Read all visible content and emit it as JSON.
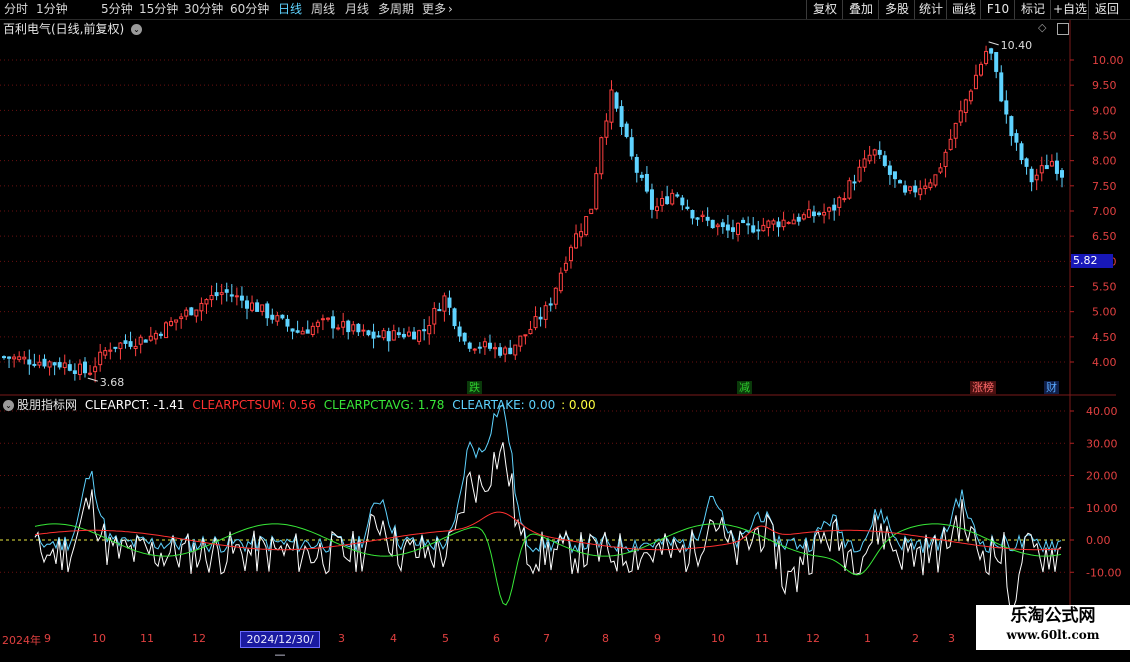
{
  "toolbar": {
    "periods": [
      "分时",
      "1分钟",
      "5分钟",
      "15分钟",
      "30分钟",
      "60分钟",
      "日线",
      "周线",
      "月线",
      "多周期"
    ],
    "active_period": "日线",
    "more_label": "更多",
    "more_icon": "chevron-right-icon",
    "actions": [
      "复权",
      "叠加",
      "多股",
      "统计",
      "画线",
      "F10",
      "标记",
      "+自选",
      "返回"
    ]
  },
  "main_chart": {
    "title": "百利电气(日线,前复权)",
    "dropdown_icon": "chevron-down-icon",
    "high_label": "10.40",
    "low_label": "3.68",
    "y_ticks": [
      "10.00",
      "9.50",
      "9.00",
      "8.50",
      "8.00",
      "7.50",
      "7.00",
      "6.50",
      "6.00",
      "5.50",
      "5.00",
      "4.50",
      "4.00"
    ],
    "current_price": "5.82",
    "events": [
      {
        "label": "跌",
        "color": "#2ecc2e"
      },
      {
        "label": "减",
        "color": "#2ecc2e"
      },
      {
        "label": "涨榜",
        "color": "#ff5a5a"
      },
      {
        "label": "财",
        "color": "#4aa0ff"
      }
    ],
    "candle_colors": {
      "up": "#ff4040",
      "down": "#5fd3ff"
    }
  },
  "indicator": {
    "name": "股朋指标网",
    "items": [
      {
        "label": "CLEARPCT: -1.41",
        "color": "#ffffff"
      },
      {
        "label": "CLEARPCTSUM: 0.56",
        "color": "#ff3030"
      },
      {
        "label": "CLEARPCTAVG: 1.78",
        "color": "#38e838"
      },
      {
        "label": "CLEARTAKE: 0.00",
        "color": "#5fd3ff"
      },
      {
        "label": ": 0.00",
        "color": "#ffff40"
      }
    ],
    "y_ticks": [
      "40.00",
      "30.00",
      "20.00",
      "10.00",
      "0.00",
      "-10.00"
    ]
  },
  "time_axis": {
    "ticks": [
      "2024年",
      "9",
      "10",
      "11",
      "12",
      "3",
      "4",
      "5",
      "6",
      "7",
      "8",
      "9",
      "10",
      "11",
      "12",
      "1",
      "2",
      "3"
    ],
    "selected_date": "2024/12/30/—"
  },
  "watermark": {
    "title": "乐淘公式网",
    "url": "www.60lt.com"
  }
}
